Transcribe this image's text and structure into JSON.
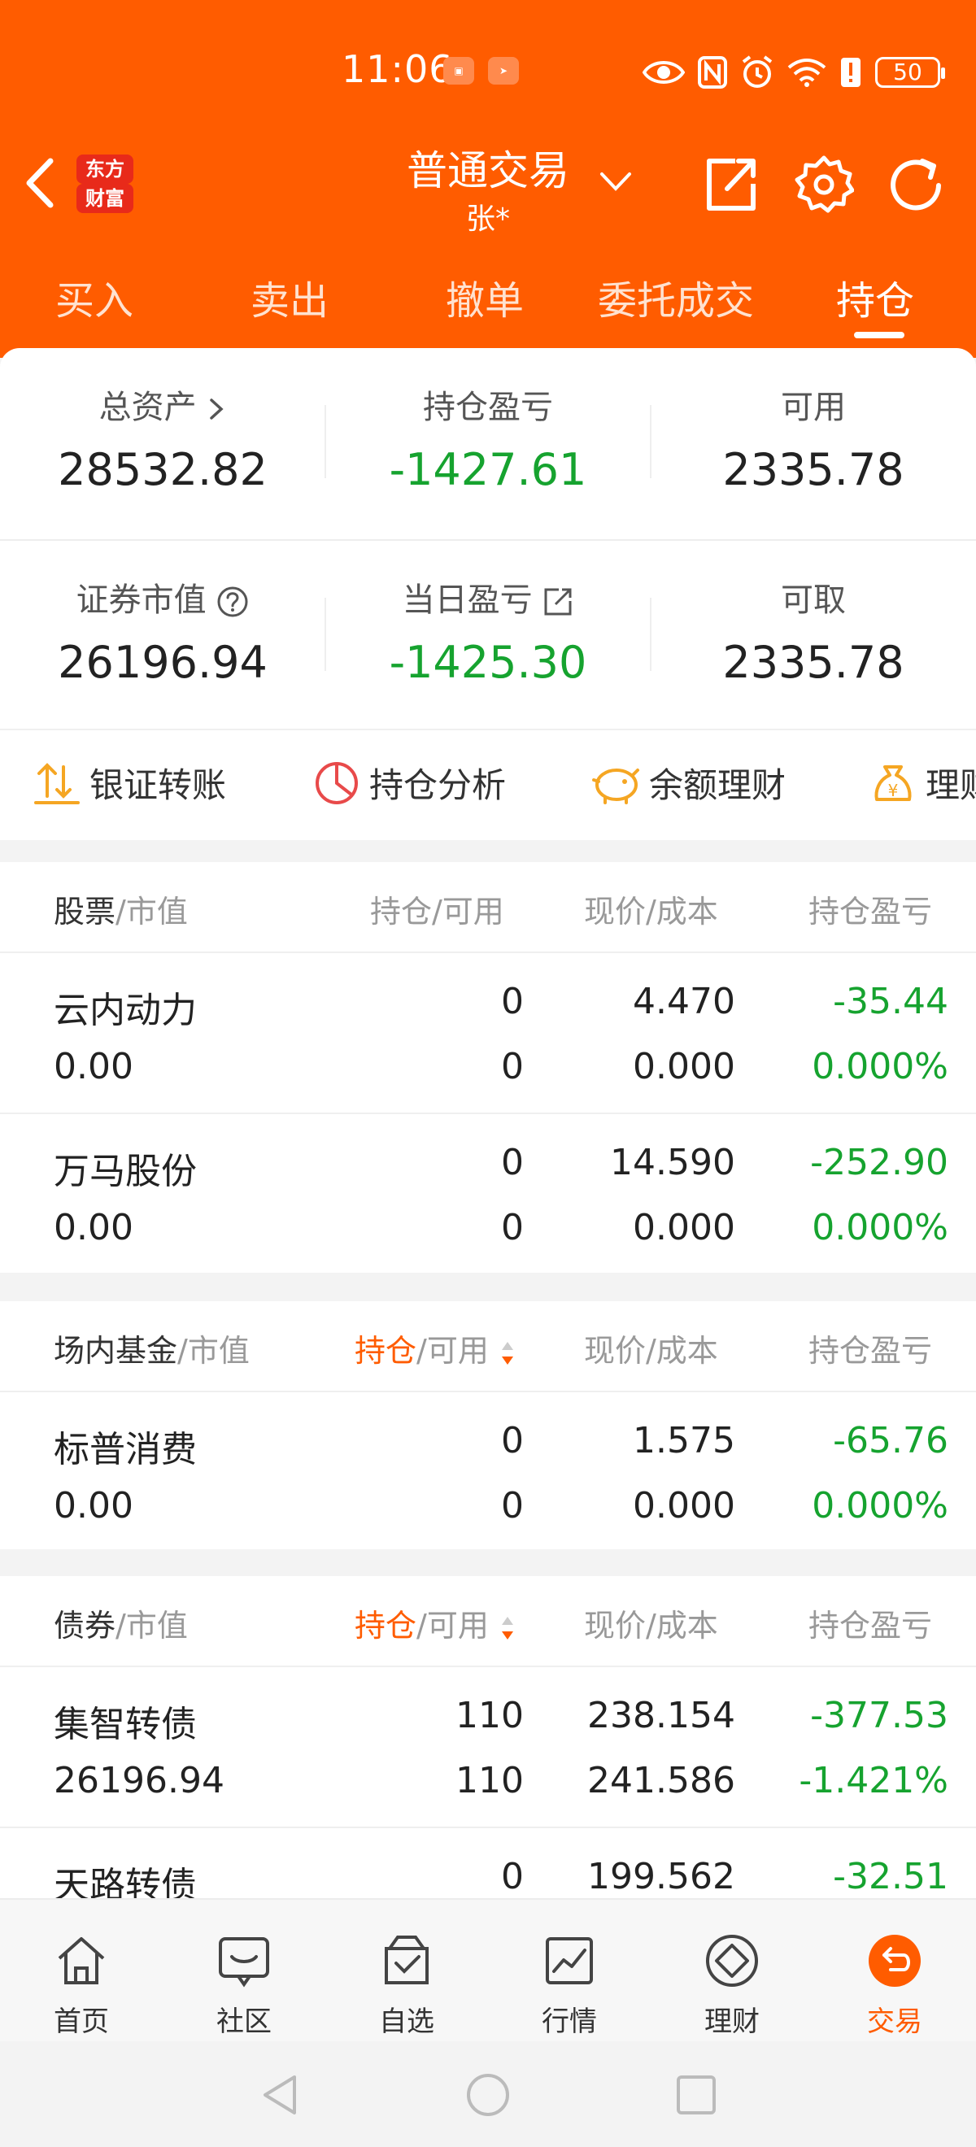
{
  "status_bar": {
    "time": "11:06",
    "battery": "50"
  },
  "nav": {
    "logo_top": "东方",
    "logo_bottom": "财富",
    "title": "普通交易",
    "subtitle": "张*"
  },
  "tabs": [
    {
      "label": "买入"
    },
    {
      "label": "卖出"
    },
    {
      "label": "撤单"
    },
    {
      "label": "委托成交"
    },
    {
      "label": "持仓",
      "active": true
    }
  ],
  "summary": {
    "total_assets_label": "总资产",
    "total_assets": "28532.82",
    "position_pnl_label": "持仓盈亏",
    "position_pnl": "-1427.61",
    "available_label": "可用",
    "available": "2335.78",
    "market_value_label": "证券市值",
    "market_value": "26196.94",
    "daily_pnl_label": "当日盈亏",
    "daily_pnl": "-1425.30",
    "withdrawable_label": "可取",
    "withdrawable": "2335.78"
  },
  "quicklinks": [
    {
      "label": "银证转账",
      "icon": "transfer-icon"
    },
    {
      "label": "持仓分析",
      "icon": "pie-chart-icon"
    },
    {
      "label": "余额理财",
      "icon": "piggy-bank-icon"
    },
    {
      "label": "理财",
      "icon": "money-bag-icon"
    }
  ],
  "sections": {
    "stocks": {
      "title": "股票",
      "title_suffix": "/市值",
      "col2": "持仓/可用",
      "col3": "现价/成本",
      "col4": "持仓盈亏",
      "rows": [
        {
          "name": "云内动力",
          "mv": "0.00",
          "hold": "0",
          "avail": "0",
          "price": "4.470",
          "cost": "0.000",
          "pnl": "-35.44",
          "pct": "0.000%"
        },
        {
          "name": "万马股份",
          "mv": "0.00",
          "hold": "0",
          "avail": "0",
          "price": "14.590",
          "cost": "0.000",
          "pnl": "-252.90",
          "pct": "0.000%"
        }
      ]
    },
    "funds": {
      "title": "场内基金",
      "title_suffix": "/市值",
      "col2a": "持仓",
      "col2b": "/可用",
      "col3": "现价/成本",
      "col4": "持仓盈亏",
      "rows": [
        {
          "name": "标普消费",
          "mv": "0.00",
          "hold": "0",
          "avail": "0",
          "price": "1.575",
          "cost": "0.000",
          "pnl": "-65.76",
          "pct": "0.000%"
        }
      ]
    },
    "bonds": {
      "title": "债券",
      "title_suffix": "/市值",
      "col2a": "持仓",
      "col2b": "/可用",
      "col3": "现价/成本",
      "col4": "持仓盈亏",
      "rows": [
        {
          "name": "集智转债",
          "mv": "26196.94",
          "hold": "110",
          "avail": "110",
          "price": "238.154",
          "cost": "241.586",
          "pnl": "-377.53",
          "pct": "-1.421%"
        },
        {
          "name": "天路转债",
          "hold": "0",
          "price": "199.562",
          "pnl": "-32.51"
        }
      ]
    }
  },
  "bottom_nav": [
    {
      "label": "首页",
      "icon": "home-icon"
    },
    {
      "label": "社区",
      "icon": "community-icon"
    },
    {
      "label": "自选",
      "icon": "watchlist-icon"
    },
    {
      "label": "行情",
      "icon": "market-icon"
    },
    {
      "label": "理财",
      "icon": "wealth-icon"
    },
    {
      "label": "交易",
      "icon": "trade-icon",
      "active": true
    }
  ],
  "colors": {
    "brand": "#ff5c00",
    "loss_green": "#16a32f"
  }
}
